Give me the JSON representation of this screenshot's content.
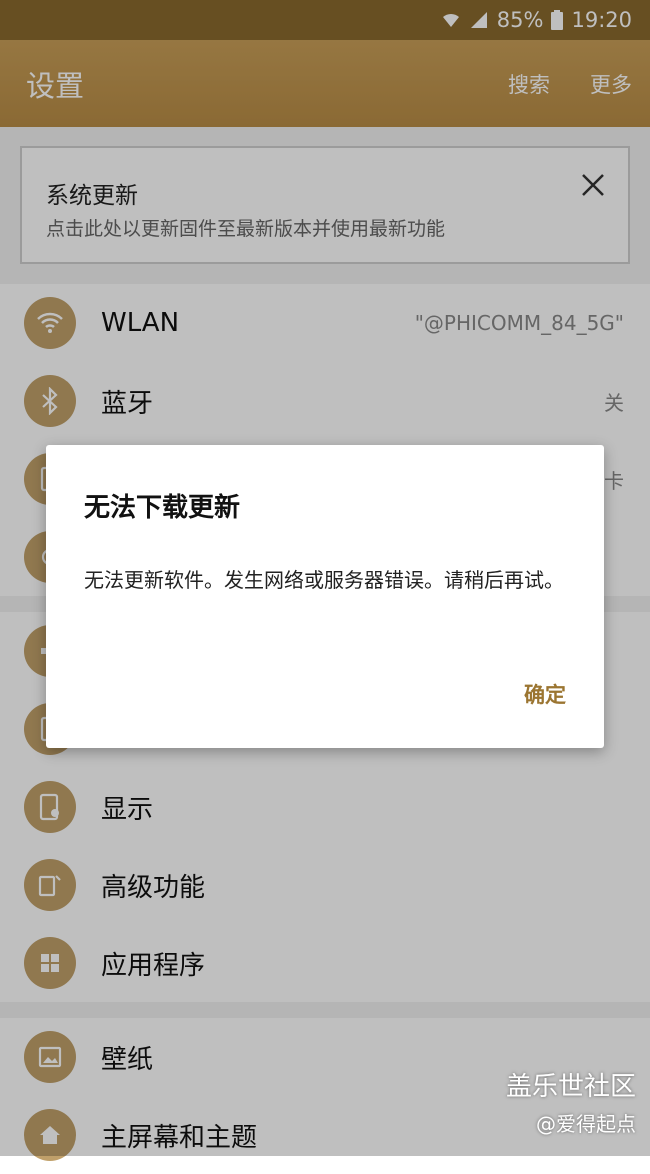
{
  "status_bar": {
    "battery": "85%",
    "time": "19:20"
  },
  "app_bar": {
    "title": "设置",
    "search": "搜索",
    "more": "更多"
  },
  "update_card": {
    "title": "系统更新",
    "description": "点击此处以更新固件至最新版本并使用最新功能"
  },
  "settings": {
    "wlan": {
      "label": "WLAN",
      "value": "\"@PHICOMM_84_5G\""
    },
    "bluetooth": {
      "label": "蓝牙",
      "value": "关"
    },
    "hidden_value": "卡",
    "display": {
      "label": "显示"
    },
    "advanced": {
      "label": "高级功能"
    },
    "apps": {
      "label": "应用程序"
    },
    "wallpaper": {
      "label": "壁纸"
    },
    "home": {
      "label": "主屏幕和主题"
    }
  },
  "dialog": {
    "title": "无法下载更新",
    "message": "无法更新软件。发生网络或服务器错误。请稍后再试。",
    "ok": "确定"
  },
  "watermark": {
    "line1": "盖乐世社区",
    "line2": "@爱得起点"
  },
  "colors": {
    "accent": "#b98d46",
    "icon_bg": "#c0a06a",
    "button": "#9b7531"
  }
}
